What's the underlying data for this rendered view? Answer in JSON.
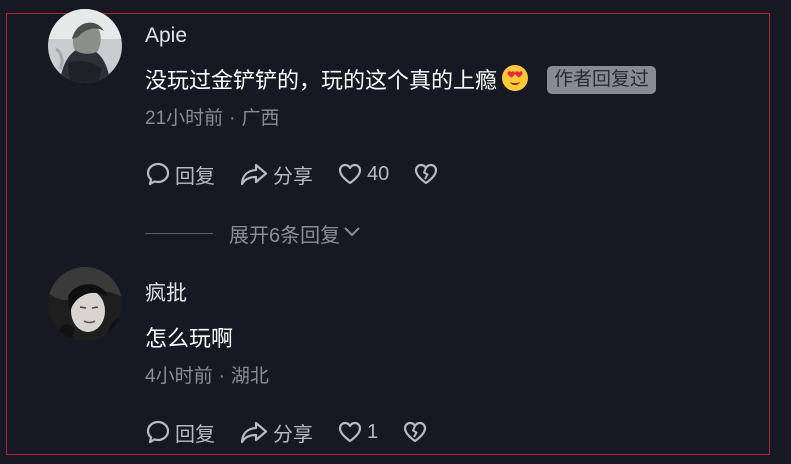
{
  "comments": [
    {
      "author": "Apie",
      "text": "没玩过金铲铲的，玩的这个真的上瘾",
      "emoji": "heart-eyes-emoji",
      "badge": "作者回复过",
      "time": "21小时前",
      "separator": "·",
      "location": "广西",
      "reply_label": "回复",
      "share_label": "分享",
      "likes": "40",
      "expand_label": "展开6条回复"
    },
    {
      "author": "疯批",
      "text": "怎么玩啊",
      "time": "4小时前",
      "separator": "·",
      "location": "湖北",
      "reply_label": "回复",
      "share_label": "分享",
      "likes": "1"
    }
  ],
  "icons": {
    "reply": "comment-bubble-icon",
    "share": "share-arrow-icon",
    "like": "heart-icon",
    "dislike": "broken-heart-icon",
    "expand": "chevron-down-icon"
  },
  "colors": {
    "background": "#161823",
    "frame": "#b3262b",
    "text_primary": "#ffffff",
    "text_secondary": "#8b8c94",
    "badge_bg": "#8a8b92"
  }
}
